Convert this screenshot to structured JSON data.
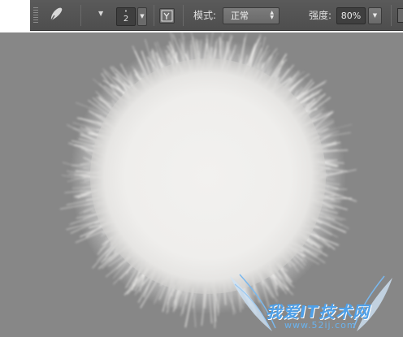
{
  "options_bar": {
    "brush_size": "2",
    "brush_size_dot": "•",
    "caret": "▼",
    "mode_label": "模式:",
    "mode_value": "正常",
    "strength_label": "强度:",
    "strength_value": "80%"
  },
  "watermark": {
    "title": "我爱IT技术网",
    "url": "www.52ij.com"
  }
}
